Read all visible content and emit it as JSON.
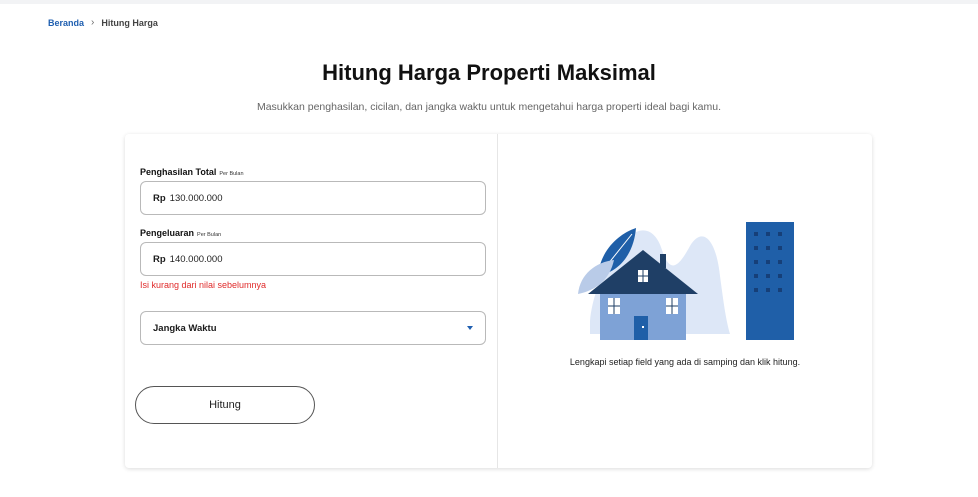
{
  "breadcrumb": {
    "home": "Beranda",
    "current": "Hitung Harga"
  },
  "page": {
    "title": "Hitung Harga Properti Maksimal",
    "subtitle": "Masukkan penghasilan, cicilan, dan jangka waktu untuk mengetahui harga properti ideal bagi kamu."
  },
  "form": {
    "income": {
      "label": "Penghasilan Total",
      "per": "Per Bulan",
      "currency": "Rp",
      "value": "130.000.000"
    },
    "expense": {
      "label": "Pengeluaran",
      "per": "Per Bulan",
      "currency": "Rp",
      "value": "140.000.000"
    },
    "error": "Isi kurang dari nilai sebelumnya",
    "term": {
      "label": "Jangka Waktu"
    },
    "submit_label": "Hitung"
  },
  "result": {
    "hint": "Lengkapi setiap field yang ada di samping dan klik hitung."
  },
  "colors": {
    "accent": "#1f5fb0",
    "error": "#e02b2b",
    "house_roof": "#1f3f66",
    "building": "#1f5fa8",
    "illus_bg": "#dde7f7"
  },
  "icons": {
    "breadcrumb_separator": "chevron-right-icon",
    "select_caret": "caret-down-icon"
  }
}
